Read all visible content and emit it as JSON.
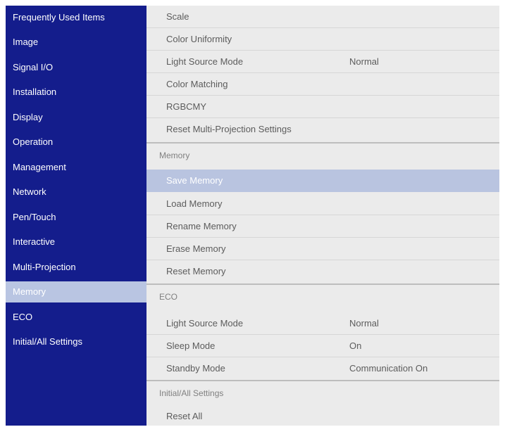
{
  "sidebar": {
    "items": [
      {
        "label": "Frequently Used Items"
      },
      {
        "label": "Image"
      },
      {
        "label": "Signal I/O"
      },
      {
        "label": "Installation"
      },
      {
        "label": "Display"
      },
      {
        "label": "Operation"
      },
      {
        "label": "Management"
      },
      {
        "label": "Network"
      },
      {
        "label": "Pen/Touch"
      },
      {
        "label": "Interactive"
      },
      {
        "label": "Multi-Projection"
      },
      {
        "label": "Memory"
      },
      {
        "label": "ECO"
      },
      {
        "label": "Initial/All Settings"
      }
    ],
    "selected": "Memory"
  },
  "main": {
    "multi_projection_items": [
      {
        "label": "Scale"
      },
      {
        "label": "Color Uniformity"
      },
      {
        "label": "Light Source Mode",
        "value": "Normal"
      },
      {
        "label": "Color Matching"
      },
      {
        "label": "RGBCMY"
      },
      {
        "label": "Reset Multi-Projection Settings"
      }
    ],
    "memory_section": {
      "title": "Memory",
      "items": [
        {
          "label": "Save Memory"
        },
        {
          "label": "Load Memory"
        },
        {
          "label": "Rename Memory"
        },
        {
          "label": "Erase Memory"
        },
        {
          "label": "Reset Memory"
        }
      ]
    },
    "eco_section": {
      "title": "ECO",
      "items": [
        {
          "label": "Light Source Mode",
          "value": "Normal"
        },
        {
          "label": "Sleep Mode",
          "value": "On"
        },
        {
          "label": "Standby Mode",
          "value": "Communication On"
        }
      ]
    },
    "initial_section": {
      "title": "Initial/All Settings",
      "items": [
        {
          "label": "Reset All"
        }
      ]
    }
  },
  "colors": {
    "sidebar_bg": "#141d8c",
    "selected_bg": "#b9c5e2",
    "panel_bg": "#ebebeb"
  }
}
